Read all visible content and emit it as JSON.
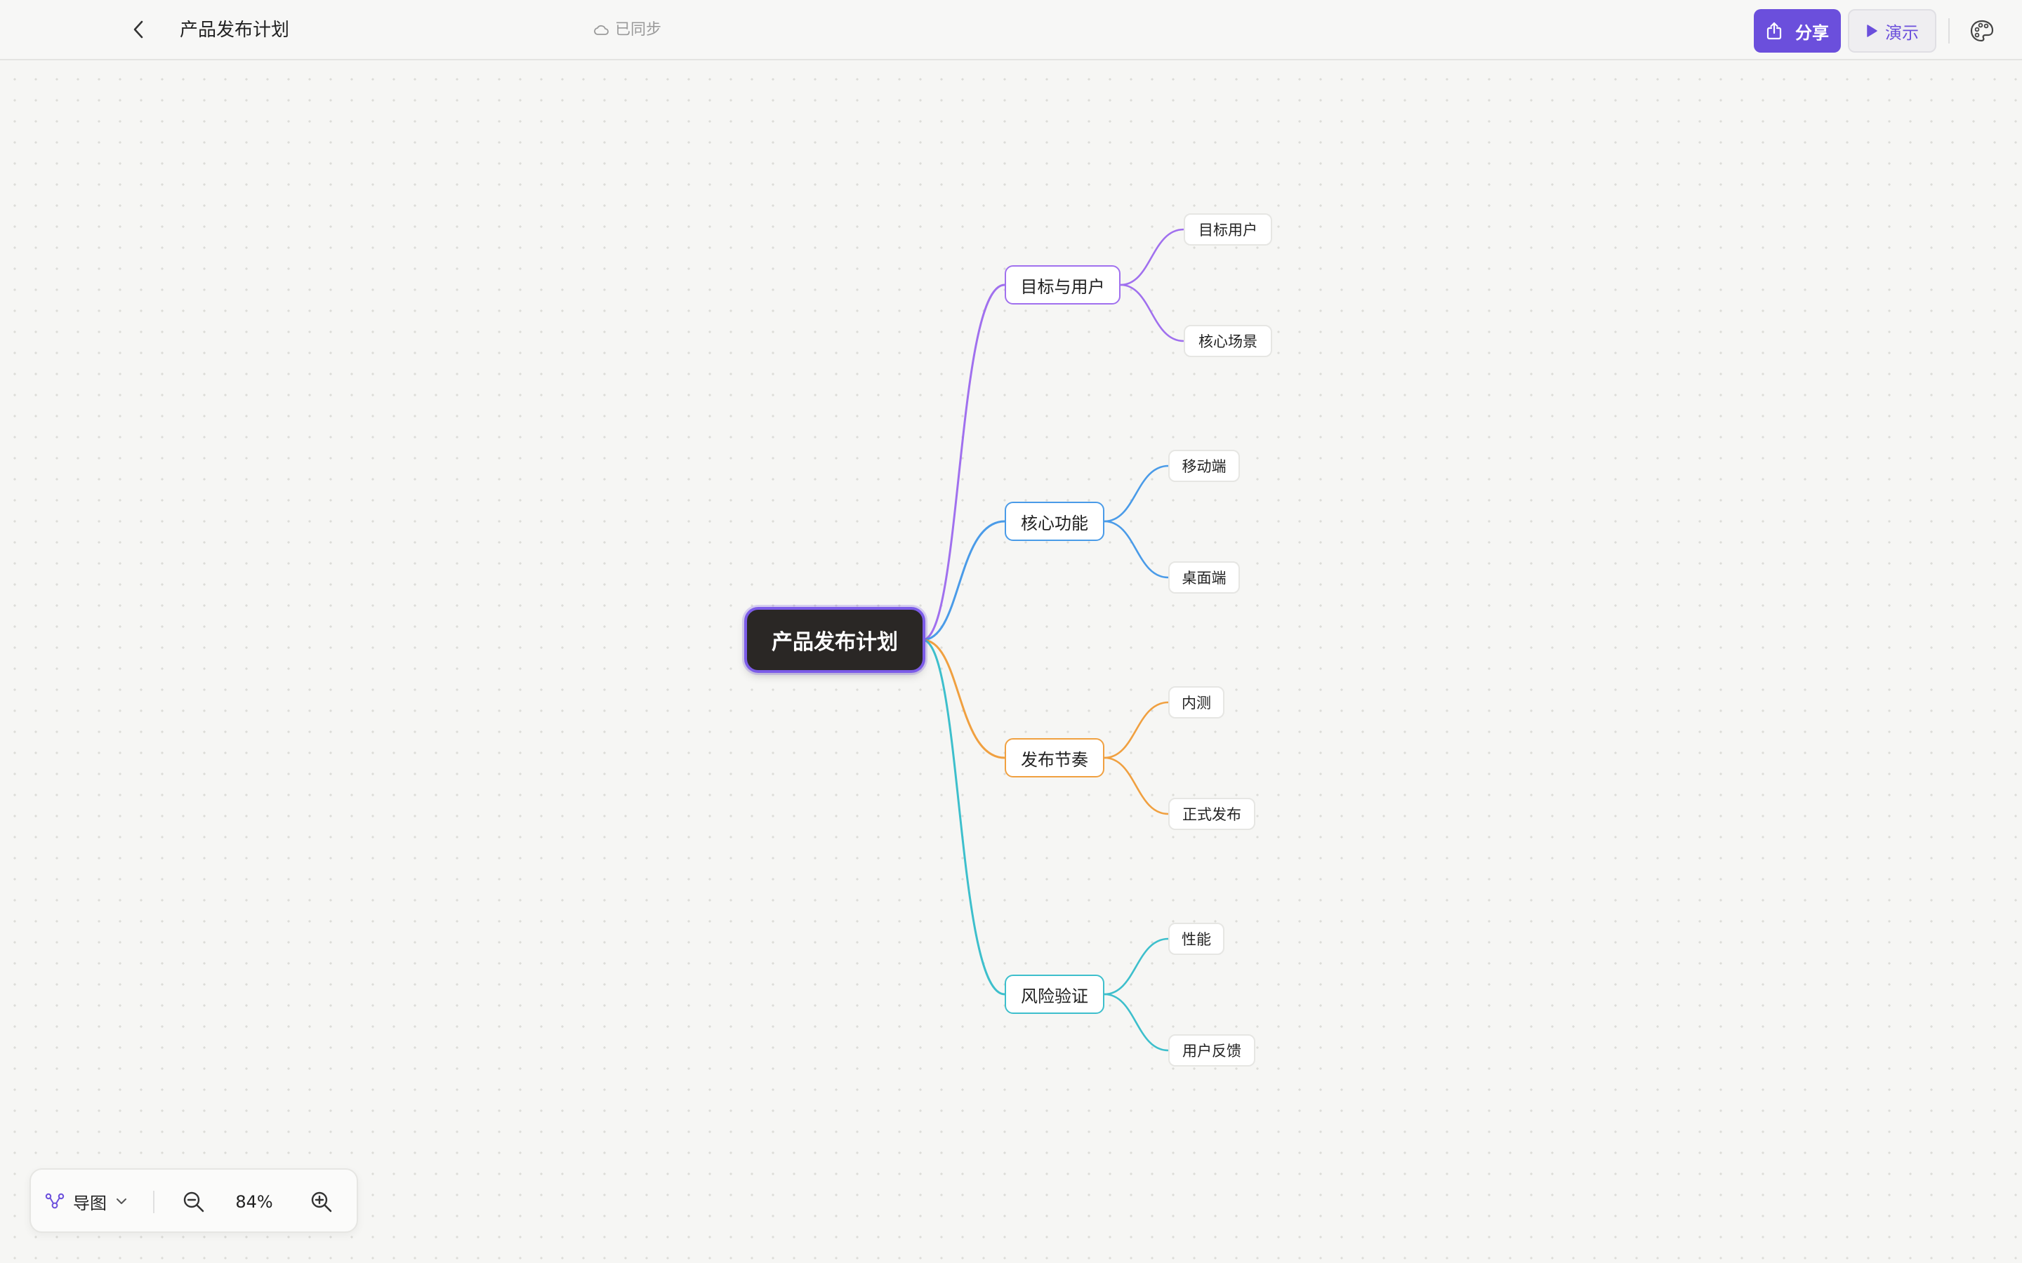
{
  "header": {
    "title": "产品发布计划",
    "sync_status": "已同步",
    "share_label": "分享",
    "present_label": "演示"
  },
  "mindmap": {
    "root": "产品发布计划",
    "accent_color": "#6b4fdc",
    "branches": [
      {
        "label": "目标与用户",
        "color": "#a070ee",
        "children": [
          "目标用户",
          "核心场景"
        ]
      },
      {
        "label": "核心功能",
        "color": "#4a9be8",
        "children": [
          "移动端",
          "桌面端"
        ]
      },
      {
        "label": "发布节奏",
        "color": "#f0a040",
        "children": [
          "内测",
          "正式发布"
        ]
      },
      {
        "label": "风险验证",
        "color": "#3dbfcc",
        "children": [
          "性能",
          "用户反馈"
        ]
      }
    ]
  },
  "toolbar": {
    "layout_label": "导图",
    "zoom_level": "84%"
  },
  "icons": {
    "back": "chevron-left-icon",
    "sync": "cloud-icon",
    "share": "share-icon",
    "present": "play-icon",
    "theme": "palette-icon",
    "layout": "mindmap-layout-icon",
    "layout_dropdown": "chevron-down-icon",
    "zoom_out": "zoom-out-icon",
    "zoom_in": "zoom-in-icon"
  }
}
